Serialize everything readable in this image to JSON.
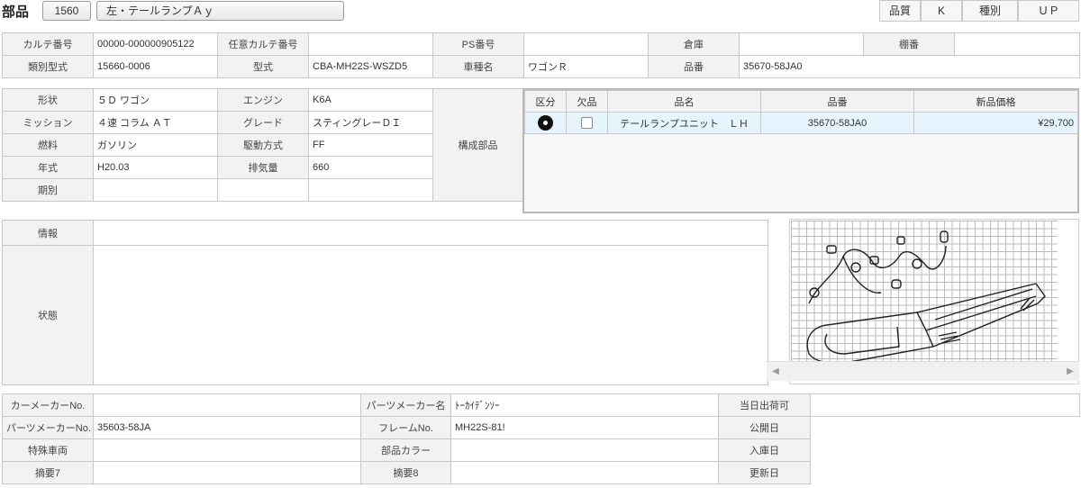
{
  "header": {
    "title": "部品",
    "code": "1560",
    "part_name": "左・テールランプＡｙ",
    "buttons": [
      "品質",
      "K",
      "種別",
      "ＵＰ"
    ]
  },
  "info1": {
    "karte_no_label": "カルテ番号",
    "karte_no": "00000-000000905122",
    "any_karte_label": "任意カルテ番号",
    "any_karte": "",
    "ps_label": "PS番号",
    "ps": "",
    "warehouse_label": "倉庫",
    "warehouse": "",
    "shelf_label": "棚番",
    "shelf": "",
    "class_model_label": "類別型式",
    "class_model": "15660-0006",
    "model_label": "型式",
    "model": "CBA-MH22S-WSZD5",
    "car_name_label": "車種名",
    "car_name": "ワゴンＲ",
    "part_no_label": "品番",
    "part_no": "35670-58JA0"
  },
  "spec": {
    "shape_label": "形状",
    "shape": "５Ｄ ワゴン",
    "engine_label": "エンジン",
    "engine": "K6A",
    "mission_label": "ミッション",
    "mission": "４速 コラム ＡＴ",
    "grade_label": "グレード",
    "grade": "スティングレーＤＩ",
    "fuel_label": "燃料",
    "fuel": "ガソリン",
    "drive_label": "駆動方式",
    "drive": "FF",
    "year_label": "年式",
    "year": "H20.03",
    "displacement_label": "排気量",
    "displacement": "660",
    "period_label": "期別",
    "period": "",
    "components_label": "構成部品"
  },
  "components": {
    "headers": [
      "区分",
      "欠品",
      "品名",
      "品番",
      "新品価格"
    ],
    "rows": [
      {
        "name": "テールランプユニット　ＬＨ",
        "part_no": "35670-58JA0",
        "price": "¥29,700"
      }
    ]
  },
  "notes": {
    "info_label": "情報",
    "info": "",
    "status_label": "状態",
    "status": ""
  },
  "bottom": {
    "car_maker_no_label": "カーメーカーNo.",
    "car_maker_no": "",
    "parts_maker_name_label": "パーツメーカー名",
    "parts_maker_name": "ﾄｰｶｲﾃﾞﾝｿｰ",
    "ship_today_label": "当日出荷可",
    "ship_today": "",
    "parts_maker_no_label": "パーツメーカーNo.",
    "parts_maker_no": "35603-58JA",
    "frame_no_label": "フレームNo.",
    "frame_no": "MH22S-81!",
    "public_date_label": "公開日",
    "public_date": "",
    "special_vehicle_label": "特殊車両",
    "special_vehicle": "",
    "part_color_label": "部品カラー",
    "part_color": "",
    "arrival_date_label": "入庫日",
    "arrival_date": "",
    "memo7_label": "摘要7",
    "memo7": "",
    "memo8_label": "摘要8",
    "memo8": "",
    "update_date_label": "更新日",
    "update_date": ""
  },
  "icons": {
    "category_icon": "disc-icon",
    "scroll_left": "arrow-left-icon",
    "scroll_right": "arrow-right-icon"
  }
}
